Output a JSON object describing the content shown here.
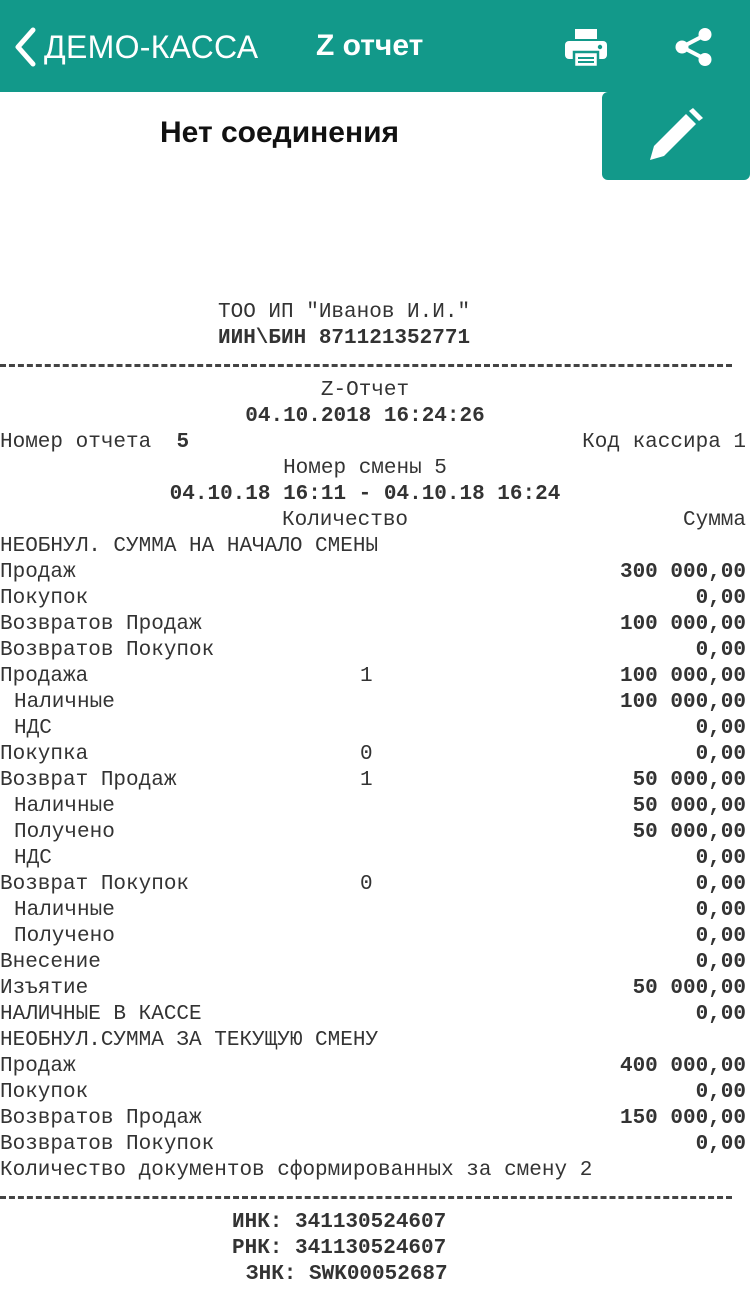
{
  "header": {
    "back_label": "ДЕМО-КАССА",
    "title": "Z отчет",
    "background": "#12998a"
  },
  "status": "Нет соединения",
  "receipt": {
    "company": "ТОО ИП \"Иванов И.И.\"",
    "inn": "ИИН\\БИН 871121352771",
    "report_name": "Z-Отчет",
    "datetime": "04.10.2018 16:24:26",
    "report_number_label": "Номер отчета",
    "report_number": "5",
    "cashier_label": "Код кассира 1",
    "shift_label": "Номер смены 5",
    "shift_period": "04.10.18 16:11 - 04.10.18 16:24",
    "qty_header": "Количество",
    "sum_header": "Сумма",
    "start_header": "НЕОБНУЛ. СУММА НА НАЧАЛО СМЕНЫ",
    "rows": [
      {
        "label": "Продаж",
        "qty": "",
        "amount": "300 000,00",
        "indent": false
      },
      {
        "label": "Покупок",
        "qty": "",
        "amount": "0,00",
        "indent": false
      },
      {
        "label": "Возвратов Продаж",
        "qty": "",
        "amount": "100 000,00",
        "indent": false
      },
      {
        "label": "Возвратов Покупок",
        "qty": "",
        "amount": "0,00",
        "indent": false
      },
      {
        "label": "Продажа",
        "qty": "1",
        "amount": "100 000,00",
        "indent": false
      },
      {
        "label": "Наличные",
        "qty": "",
        "amount": "100 000,00",
        "indent": true
      },
      {
        "label": "НДС",
        "qty": "",
        "amount": "0,00",
        "indent": true
      },
      {
        "label": "Покупка",
        "qty": "0",
        "amount": "0,00",
        "indent": false
      },
      {
        "label": "Возврат Продаж",
        "qty": "1",
        "amount": "50 000,00",
        "indent": false
      },
      {
        "label": "Наличные",
        "qty": "",
        "amount": "50 000,00",
        "indent": true
      },
      {
        "label": "Получено",
        "qty": "",
        "amount": "50 000,00",
        "indent": true
      },
      {
        "label": "НДС",
        "qty": "",
        "amount": "0,00",
        "indent": true
      },
      {
        "label": "Возврат Покупок",
        "qty": "0",
        "amount": "0,00",
        "indent": false
      },
      {
        "label": "Наличные",
        "qty": "",
        "amount": "0,00",
        "indent": true
      },
      {
        "label": "Получено",
        "qty": "",
        "amount": "0,00",
        "indent": true
      },
      {
        "label": "Внесение",
        "qty": "",
        "amount": "0,00",
        "indent": false
      },
      {
        "label": "Изъятие",
        "qty": "",
        "amount": "50 000,00",
        "indent": false
      },
      {
        "label": "НАЛИЧНЫЕ В КАССЕ",
        "qty": "",
        "amount": "0,00",
        "indent": false
      }
    ],
    "current_header": "НЕОБНУЛ.СУММА ЗА ТЕКУЩУЮ СМЕНУ",
    "current_rows": [
      {
        "label": "Продаж",
        "amount": "400 000,00"
      },
      {
        "label": "Покупок",
        "amount": "0,00"
      },
      {
        "label": "Возвратов Продаж",
        "amount": "150 000,00"
      },
      {
        "label": "Возвратов Покупок",
        "amount": "0,00"
      }
    ],
    "docs_count": "Количество документов сформированных за смену 2",
    "inc": "ИНК: 341130524607",
    "rnk": "РНК: 341130524607",
    "znk": "ЗНК: SWK00052687"
  }
}
